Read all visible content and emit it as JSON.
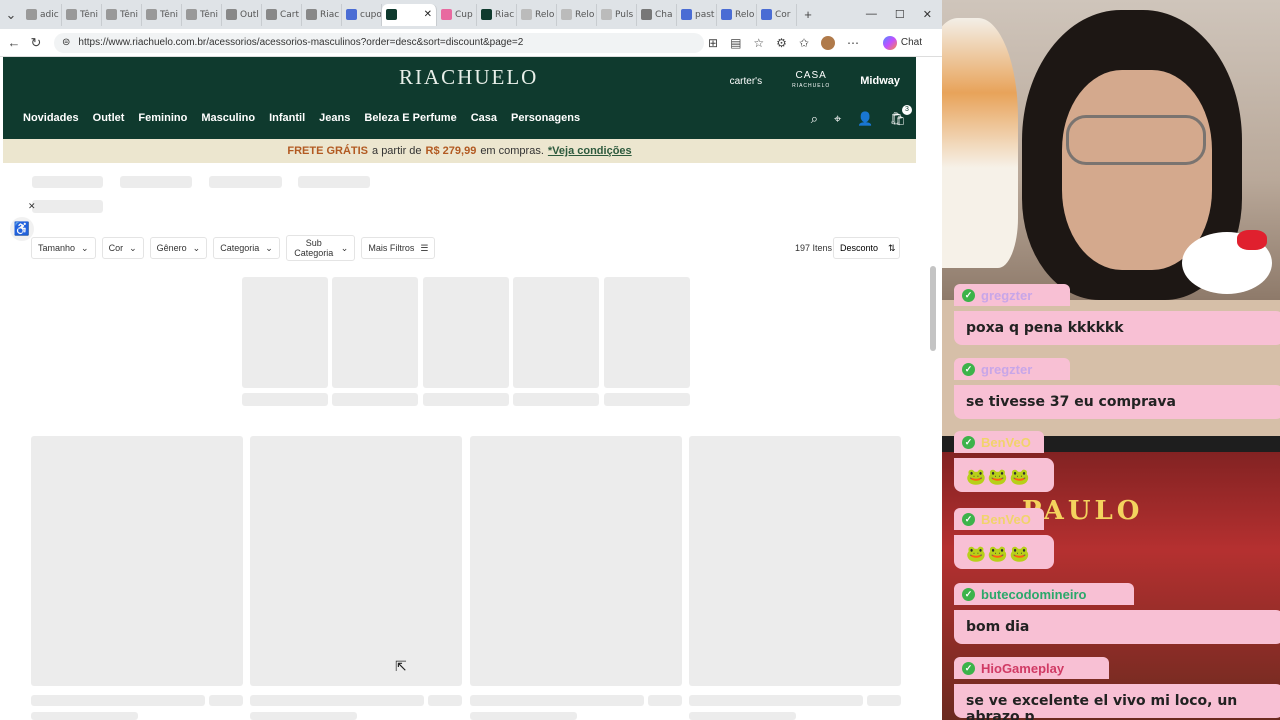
{
  "browser": {
    "tabs": [
      {
        "label": "adic",
        "color": "#999"
      },
      {
        "label": "Têni",
        "color": "#999"
      },
      {
        "label": "Têni",
        "color": "#999"
      },
      {
        "label": "Têni",
        "color": "#999"
      },
      {
        "label": "Têni",
        "color": "#999"
      },
      {
        "label": "Outl",
        "color": "#888"
      },
      {
        "label": "Cart",
        "color": "#888"
      },
      {
        "label": "Riac",
        "color": "#888"
      },
      {
        "label": "cupo",
        "color": "#4a6cd4"
      },
      {
        "label": "",
        "color": "#0f3a2e"
      },
      {
        "label": "Cup",
        "color": "#e86aa0"
      },
      {
        "label": "Riac",
        "color": "#0f3a2e"
      },
      {
        "label": "Relo",
        "color": "#bbb"
      },
      {
        "label": "Relo",
        "color": "#bbb"
      },
      {
        "label": "Puls",
        "color": "#bbb"
      },
      {
        "label": "Cha",
        "color": "#777"
      },
      {
        "label": "past",
        "color": "#4a6cd4"
      },
      {
        "label": "Relo",
        "color": "#4a6cd4"
      },
      {
        "label": "Cor",
        "color": "#4a6cd4"
      }
    ],
    "url": "https://www.riachuelo.com.br/acessorios/acessorios-masculinos?order=desc&sort=discount&page=2",
    "chat_label": "Chat"
  },
  "site": {
    "logo": "RIACHUELO",
    "brands": {
      "carters": "carter's",
      "casa": "CASA",
      "casa_sub": "RIACHUELO",
      "midway": "Midway"
    },
    "menu": [
      "Novidades",
      "Outlet",
      "Feminino",
      "Masculino",
      "Infantil",
      "Jeans",
      "Beleza E Perfume",
      "Casa",
      "Personagens"
    ],
    "cart_count": "3"
  },
  "promo": {
    "highlight1": "FRETE GRÁTIS",
    "text1": "a partir de",
    "highlight2": "R$ 279,99",
    "text2": "em compras.",
    "link": "*Veja condições"
  },
  "filters": {
    "items": [
      {
        "label": "Tamanho"
      },
      {
        "label": "Cor"
      },
      {
        "label": "Gênero"
      },
      {
        "label": "Categoria"
      },
      {
        "label": "Sub Categoria"
      }
    ],
    "more_filters": "Mais Filtros",
    "items_count": "197 Itens",
    "sort": "Desconto"
  },
  "chat": {
    "messages": [
      {
        "user": "gregzter",
        "text": "poxa q pena kkkkkk"
      },
      {
        "user": "gregzter",
        "text": "se tivesse 37 eu comprava"
      },
      {
        "user": "BenVeO",
        "text": ""
      },
      {
        "user": "BenVeO",
        "text": ""
      },
      {
        "user": "butecodomineiro",
        "text": "bom dia"
      },
      {
        "user": "HioGameplay",
        "text": "se ve excelente el vivo mi loco, un abrazo p"
      }
    ],
    "name_colors": {
      "gregzter": "#c8a6e8",
      "BenVeO": "#f1d36b",
      "butecodomineiro": "#2aa86a",
      "HioGameplay": "#d03a64"
    },
    "overlay_text": "PAULO"
  }
}
